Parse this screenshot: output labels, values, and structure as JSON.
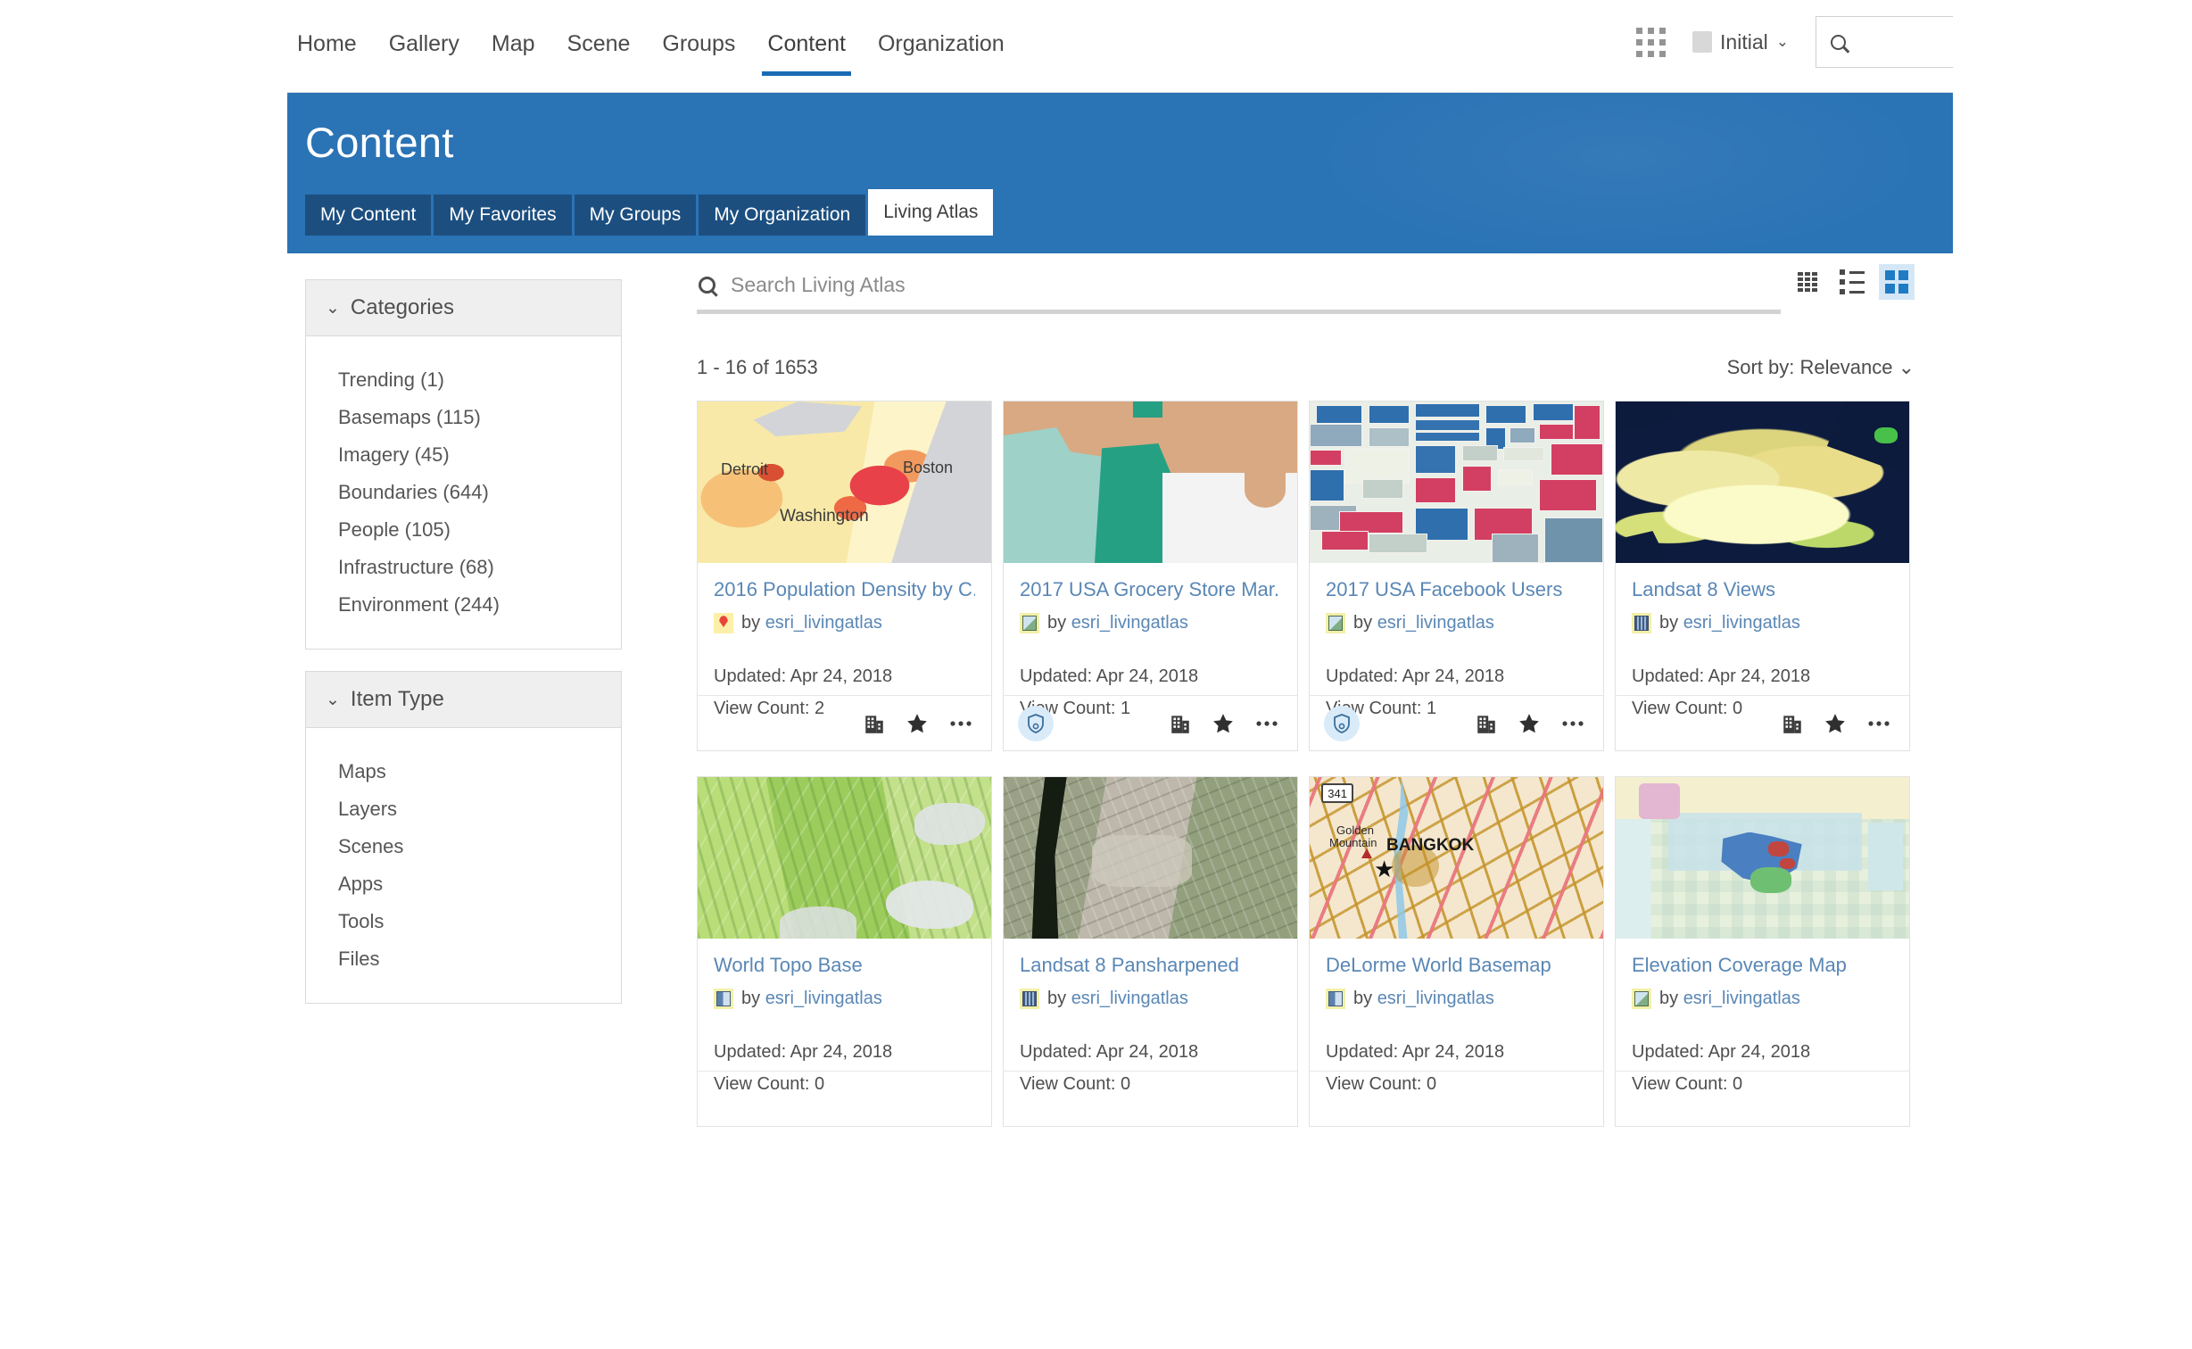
{
  "topnav": {
    "links": [
      {
        "label": "Home",
        "active": false
      },
      {
        "label": "Gallery",
        "active": false
      },
      {
        "label": "Map",
        "active": false
      },
      {
        "label": "Scene",
        "active": false
      },
      {
        "label": "Groups",
        "active": false
      },
      {
        "label": "Content",
        "active": true
      },
      {
        "label": "Organization",
        "active": false
      }
    ],
    "app_switcher_icon": "app-grid-icon",
    "user": "Initial",
    "user_chevron": "⌄",
    "search_icon": "search-icon",
    "search_value": "",
    "search_placeholder": ""
  },
  "header": {
    "title": "Content",
    "background_color": "#2a73b5",
    "tabs": [
      {
        "label": "My Content",
        "active": false
      },
      {
        "label": "My Favorites",
        "active": false
      },
      {
        "label": "My Groups",
        "active": false
      },
      {
        "label": "My Organization",
        "active": false
      },
      {
        "label": "Living Atlas",
        "active": true
      }
    ]
  },
  "sidebar": {
    "facets": [
      {
        "title": "Categories",
        "chevron": "⌄",
        "items": [
          {
            "label": "Trending (1)"
          },
          {
            "label": "Basemaps (115)"
          },
          {
            "label": "Imagery (45)"
          },
          {
            "label": "Boundaries (644)"
          },
          {
            "label": "People (105)"
          },
          {
            "label": "Infrastructure (68)"
          },
          {
            "label": "Environment (244)"
          }
        ]
      },
      {
        "title": "Item Type",
        "chevron": "⌄",
        "items": [
          {
            "label": "Maps"
          },
          {
            "label": "Layers"
          },
          {
            "label": "Scenes"
          },
          {
            "label": "Apps"
          },
          {
            "label": "Tools"
          },
          {
            "label": "Files"
          }
        ]
      }
    ]
  },
  "results": {
    "search_placeholder": "Search Living Atlas",
    "search_value": "",
    "search_icon": "search-icon",
    "count_text": "1 - 16 of 1653",
    "sort_text": "Sort by: Relevance",
    "sort_chevron": "⌄",
    "views": [
      {
        "name": "table-view-icon",
        "active": false
      },
      {
        "name": "list-view-icon",
        "active": false
      },
      {
        "name": "grid-view-icon",
        "active": true
      }
    ],
    "active_view_color": "#d5e7f7",
    "cards": [
      {
        "title": "2016 Population Density by C...",
        "type_icon": "map-item-icon",
        "by_label": "by",
        "author": "esri_livingatlas",
        "updated": "Updated: Apr 24, 2018",
        "views": "View Count: 2",
        "authoritative": false,
        "footer_icons": [
          "organization-icon",
          "favorite-star-icon",
          "more-options-icon"
        ],
        "thumb": "population-density-choropleth",
        "thumb_labels": [
          "Detroit",
          "Boston",
          "Washington"
        ]
      },
      {
        "title": "2017 USA Grocery Store Mar...",
        "type_icon": "layer-item-icon",
        "by_label": "by",
        "author": "esri_livingatlas",
        "updated": "Updated: Apr 24, 2018",
        "views": "View Count: 1",
        "authoritative": true,
        "footer_icons": [
          "organization-icon",
          "favorite-star-icon",
          "more-options-icon"
        ],
        "thumb": "grocery-market-teal-tan",
        "thumb_labels": []
      },
      {
        "title": "2017 USA Facebook Users",
        "type_icon": "layer-item-icon",
        "by_label": "by",
        "author": "esri_livingatlas",
        "updated": "Updated: Apr 24, 2018",
        "views": "View Count: 1",
        "authoritative": true,
        "footer_icons": [
          "organization-icon",
          "favorite-star-icon",
          "more-options-icon"
        ],
        "thumb": "facebook-users-blocks",
        "thumb_labels": []
      },
      {
        "title": "Landsat 8 Views",
        "type_icon": "imagery-item-icon",
        "by_label": "by",
        "author": "esri_livingatlas",
        "updated": "Updated: Apr 24, 2018",
        "views": "View Count: 0",
        "authoritative": false,
        "footer_icons": [
          "organization-icon",
          "favorite-star-icon",
          "more-options-icon"
        ],
        "thumb": "landsat-satellite-yellow",
        "thumb_labels": []
      },
      {
        "title": "World Topo Base",
        "type_icon": "tile-item-icon",
        "by_label": "by",
        "author": "esri_livingatlas",
        "updated": "Updated: Apr 24, 2018",
        "views": "View Count: 0",
        "authoritative": false,
        "footer_icons": [],
        "thumb": "topo-green-hills",
        "thumb_labels": []
      },
      {
        "title": "Landsat 8 Pansharpened",
        "type_icon": "imagery-item-icon",
        "by_label": "by",
        "author": "esri_livingatlas",
        "updated": "Updated: Apr 24, 2018",
        "views": "View Count: 0",
        "authoritative": false,
        "footer_icons": [],
        "thumb": "pansharpened-river-imagery",
        "thumb_labels": []
      },
      {
        "title": "DeLorme World Basemap",
        "type_icon": "tile-item-icon",
        "by_label": "by",
        "author": "esri_livingatlas",
        "updated": "Updated: Apr 24, 2018",
        "views": "View Count: 0",
        "authoritative": false,
        "footer_icons": [],
        "thumb": "delorme-bangkok-map",
        "thumb_labels": [
          "341",
          "Golden",
          "Mountain",
          "BANGKOK"
        ]
      },
      {
        "title": "Elevation Coverage Map",
        "type_icon": "layer-item-icon",
        "by_label": "by",
        "author": "esri_livingatlas",
        "updated": "Updated: Apr 24, 2018",
        "views": "View Count: 0",
        "authoritative": false,
        "footer_icons": [],
        "thumb": "elevation-coverage-tiles",
        "thumb_labels": []
      }
    ]
  }
}
